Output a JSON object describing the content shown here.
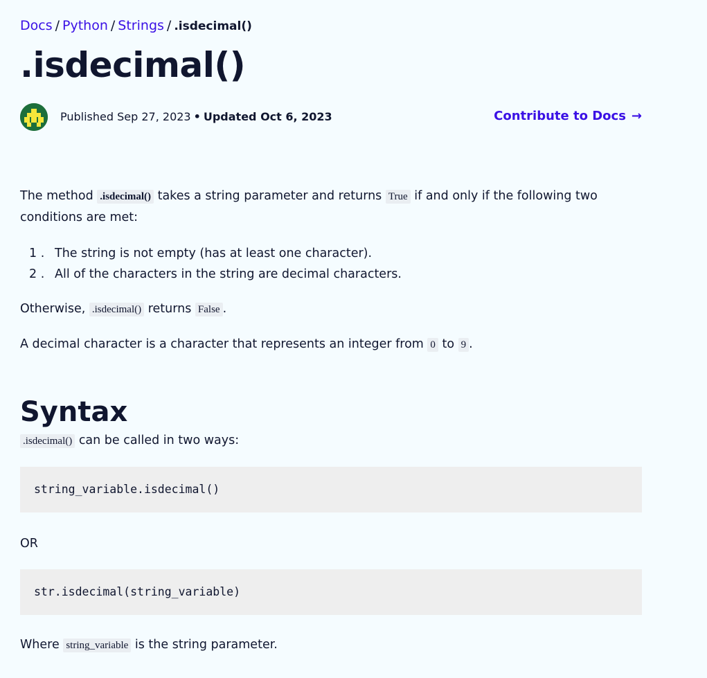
{
  "breadcrumb": {
    "items": [
      "Docs",
      "Python",
      "Strings"
    ],
    "separator": "/",
    "current": ".isdecimal()"
  },
  "title": ".isdecimal()",
  "meta": {
    "published": "Published Sep 27, 2023",
    "dot": "•",
    "updated": "Updated Oct 6, 2023"
  },
  "contribute": {
    "label": "Contribute to Docs",
    "arrow": "→"
  },
  "intro": {
    "t1": "The method",
    "code1": ".isdecimal()",
    "t2": "takes a string parameter and returns",
    "code2": "True",
    "t3": "if and only if the following two conditions are met:"
  },
  "conditions": [
    {
      "num": "1 .",
      "text": "The string is not empty (has at least one character)."
    },
    {
      "num": "2 .",
      "text": "All of the characters in the string are decimal characters."
    }
  ],
  "otherwise": {
    "t1": "Otherwise,",
    "code1": ".isdecimal()",
    "t2": "returns",
    "code2": "False",
    "t3": "."
  },
  "decimal_def": {
    "t1": "A decimal character is a character that represents an integer from",
    "code1": "0",
    "t2": "to",
    "code2": "9",
    "t3": "."
  },
  "syntax": {
    "heading": "Syntax",
    "code1": ".isdecimal()",
    "t1": "can be called in two ways:",
    "block1": "string_variable.isdecimal()",
    "or": "OR",
    "block2": "str.isdecimal(string_variable)",
    "where_t1": "Where",
    "where_code": "string_variable",
    "where_t2": "is the string parameter."
  },
  "colors": {
    "link": "#3a10e5",
    "text": "#10162f",
    "background": "#f5fcff",
    "avatar": "#1d6f3b",
    "avatar_pattern": "#f5e63b"
  },
  "icons": {
    "avatar": "pixel-avatar-icon",
    "arrow": "right-arrow-icon"
  }
}
